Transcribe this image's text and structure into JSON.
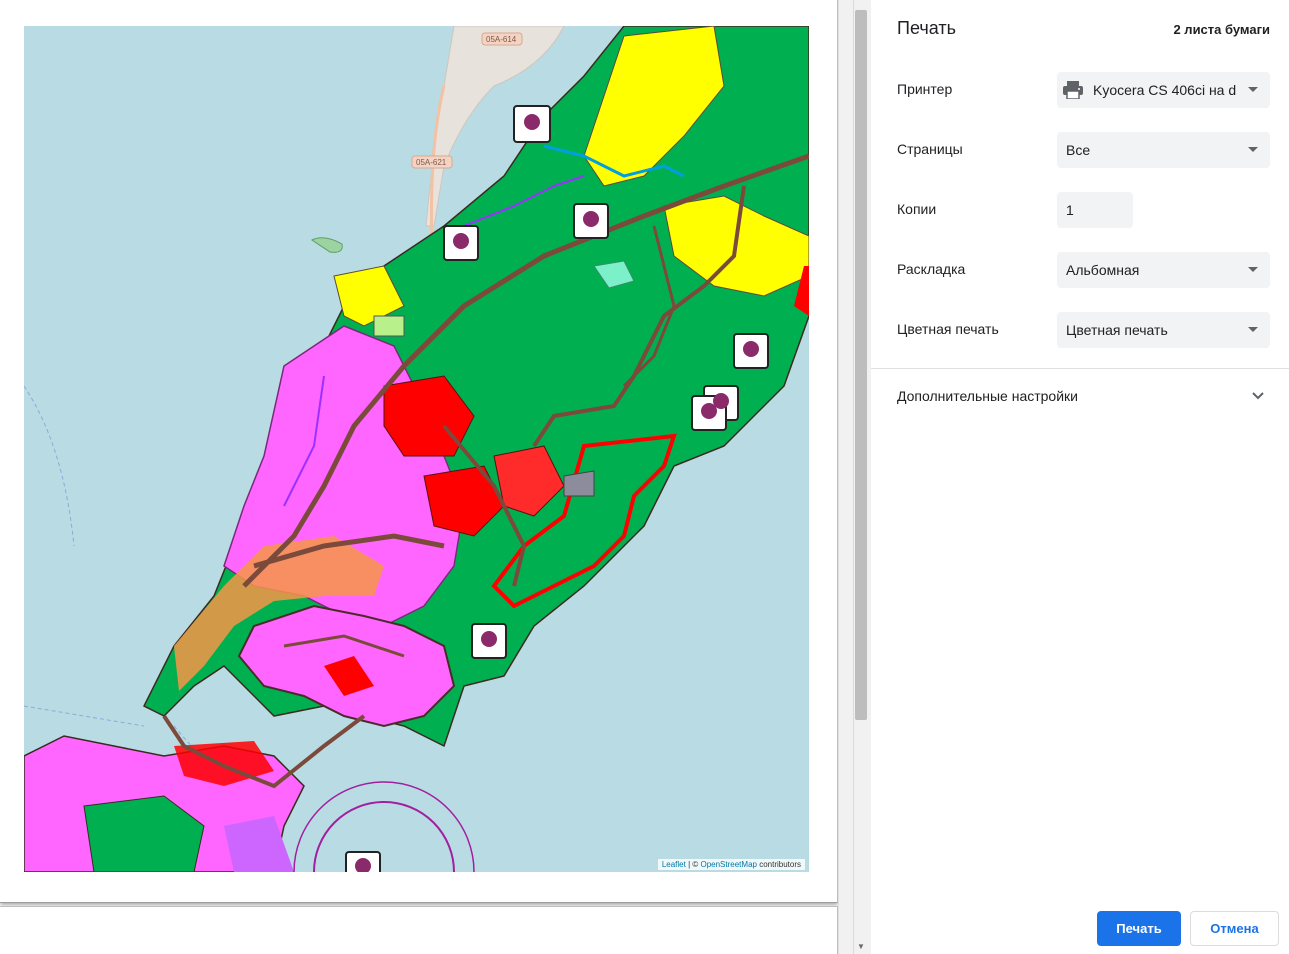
{
  "preview": {
    "attribution": {
      "leaflet": "Leaflet",
      "separator": " | © ",
      "osm": "OpenStreetMap",
      "suffix": " contributors"
    },
    "road_labels": [
      "05A-614",
      "05A-621"
    ]
  },
  "panel": {
    "title": "Печать",
    "sheet_count": "2 листа бумаги",
    "printer": {
      "label": "Принтер",
      "value": "Kyocera CS 406ci на d",
      "icon": "printer-icon"
    },
    "pages": {
      "label": "Страницы",
      "value": "Все"
    },
    "copies": {
      "label": "Копии",
      "value": "1"
    },
    "layout": {
      "label": "Раскладка",
      "value": "Альбомная"
    },
    "color": {
      "label": "Цветная печать",
      "value": "Цветная печать"
    },
    "more_settings": "Дополнительные настройки",
    "print_button": "Печать",
    "cancel_button": "Отмена"
  },
  "colors": {
    "accent": "#1a73e8",
    "water": "#b9dbe3",
    "zone_green": "#00b050",
    "zone_yellow": "#ffff00",
    "zone_red": "#ff0000",
    "zone_pink": "#ff66ff",
    "zone_orange": "#f79646",
    "road_brown": "#7b4a3a"
  }
}
